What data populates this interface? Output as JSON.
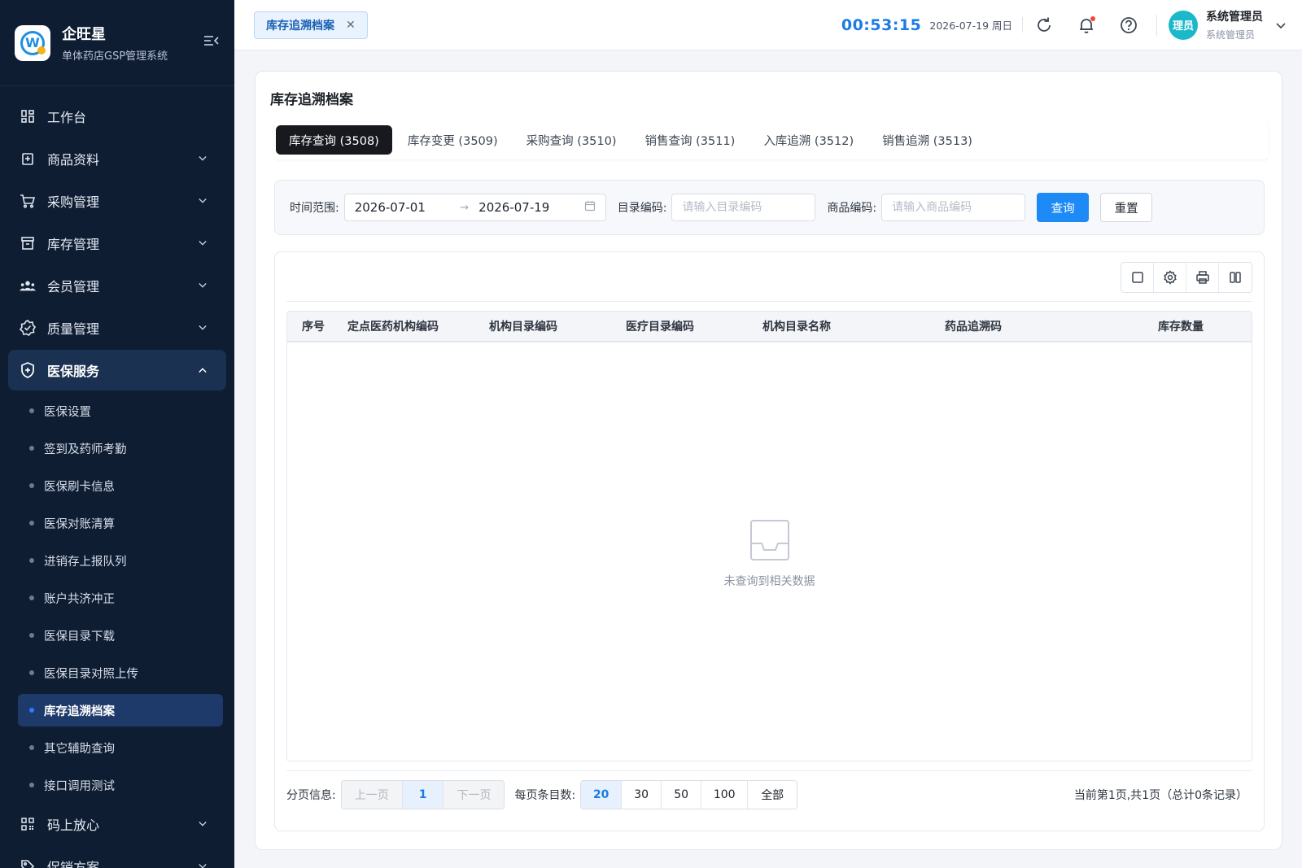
{
  "brand": {
    "title": "企旺星",
    "subtitle": "单体药店GSP管理系统",
    "logo_letter": "W"
  },
  "sidebar": {
    "menu_top": [
      {
        "label": "工作台",
        "icon": "dashboard-icon"
      },
      {
        "label": "商品资料",
        "icon": "product-icon"
      },
      {
        "label": "采购管理",
        "icon": "cart-icon"
      },
      {
        "label": "库存管理",
        "icon": "inventory-icon"
      },
      {
        "label": "会员管理",
        "icon": "members-icon"
      },
      {
        "label": "质量管理",
        "icon": "quality-icon"
      }
    ],
    "open_menu": {
      "label": "医保服务",
      "icon": "shield-icon"
    },
    "sub_items": [
      "医保设置",
      "签到及药师考勤",
      "医保刷卡信息",
      "医保对账清算",
      "进销存上报队列",
      "账户共济冲正",
      "医保目录下载",
      "医保目录对照上传",
      "库存追溯档案",
      "其它辅助查询",
      "接口调用测试"
    ],
    "active_sub": "库存追溯档案",
    "menu_bottom": [
      {
        "label": "码上放心",
        "icon": "qrcode-icon"
      },
      {
        "label": "促销方案",
        "icon": "tag-icon"
      }
    ]
  },
  "header": {
    "tab": "库存追溯档案",
    "time": "00:53:15",
    "date": "2026-07-19 周日",
    "avatar": "理员",
    "user_name": "系统管理员",
    "user_role": "系统管理员"
  },
  "page": {
    "title": "库存追溯档案",
    "tabs": [
      "库存查询 (3508)",
      "库存变更 (3509)",
      "采购查询 (3510)",
      "销售查询 (3511)",
      "入库追溯 (3512)",
      "销售追溯 (3513)"
    ],
    "filter": {
      "time_label": "时间范围:",
      "start_date": "2026-07-01",
      "end_date": "2026-07-19",
      "catalog_label": "目录编码:",
      "catalog_placeholder": "请输入目录编码",
      "product_label": "商品编码:",
      "product_placeholder": "请输入商品编码",
      "query_btn": "查询",
      "reset_btn": "重置"
    },
    "table": {
      "columns": [
        "序号",
        "定点医药机构编码",
        "机构目录编码",
        "医疗目录编码",
        "机构目录名称",
        "药品追溯码",
        "库存数量"
      ],
      "empty_text": "未查询到相关数据"
    },
    "pager": {
      "info_label": "分页信息:",
      "prev": "上一页",
      "current": "1",
      "next": "下一页",
      "size_label": "每页条目数:",
      "sizes": [
        "20",
        "30",
        "50",
        "100",
        "全部"
      ],
      "selected_size": "20",
      "status": "当前第1页,共1页（总计0条记录）"
    }
  },
  "colors": {
    "primary": "#1d8af5",
    "sidebar_bg": "#0f1d33",
    "active_tab": "#17191e"
  }
}
